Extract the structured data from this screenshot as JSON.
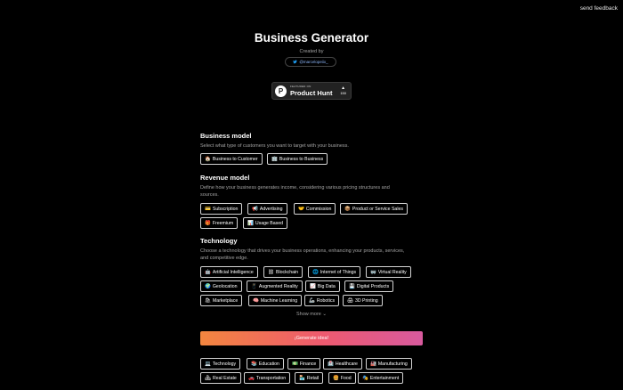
{
  "header": {
    "feedback": "send feedback",
    "title": "Business Generator",
    "created_by": "Created by",
    "twitter_handle": "@marcelopeiix_"
  },
  "product_hunt": {
    "featured": "FEATURED ON",
    "name": "Product Hunt",
    "votes": "150",
    "logo_letter": "P"
  },
  "business_model": {
    "heading": "Business model",
    "description": "Select what type of customers you want to target with your business.",
    "options": [
      {
        "icon": "🏠",
        "label": "Business to Customer"
      },
      {
        "icon": "🏢",
        "label": "Business to Business"
      }
    ]
  },
  "revenue_model": {
    "heading": "Revenue model",
    "description_1": "Define how your business generates income, considering various pricing structures and",
    "description_2": "sources.",
    "options": [
      {
        "icon": "💳",
        "label": "Subscription"
      },
      {
        "icon": "📢",
        "label": "Advertising"
      },
      {
        "icon": "🤝",
        "label": "Commission"
      },
      {
        "icon": "📦",
        "label": "Product or Service Sales"
      },
      {
        "icon": "🎁",
        "label": "Freemium"
      },
      {
        "icon": "📊",
        "label": "Usage Based"
      }
    ]
  },
  "technology": {
    "heading": "Technology",
    "description_1": "Choose a technology that drives your business operations, enhancing your products, services,",
    "description_2": "and competitive edge.",
    "options": [
      {
        "icon": "🤖",
        "label": "Artificial Intelligence"
      },
      {
        "icon": "⛓",
        "label": "Blockchain"
      },
      {
        "icon": "🌐",
        "label": "Internet of Things"
      },
      {
        "icon": "🥽",
        "label": "Virtual Reality"
      },
      {
        "icon": "🌍",
        "label": "Geolocation"
      },
      {
        "icon": "📱",
        "label": "Augmented Reality"
      },
      {
        "icon": "📈",
        "label": "Big Data"
      },
      {
        "icon": "💾",
        "label": "Digital Products"
      },
      {
        "icon": "🛍",
        "label": "Marketplace"
      },
      {
        "icon": "🧠",
        "label": "Machine Learning"
      },
      {
        "icon": "🦾",
        "label": "Robotics"
      },
      {
        "icon": "🖨",
        "label": "3D Printing"
      }
    ],
    "show_more": "Show more"
  },
  "generate": {
    "label": "¡Generate idea!"
  },
  "industries": {
    "options": [
      {
        "icon": "💻",
        "label": "Technology"
      },
      {
        "icon": "📚",
        "label": "Education"
      },
      {
        "icon": "💵",
        "label": "Finance"
      },
      {
        "icon": "🏥",
        "label": "Healthcare"
      },
      {
        "icon": "🏭",
        "label": "Manufacturing"
      },
      {
        "icon": "🏘",
        "label": "Real Estate"
      },
      {
        "icon": "🚗",
        "label": "Transportation"
      },
      {
        "icon": "🏪",
        "label": "Retail"
      },
      {
        "icon": "🍔",
        "label": "Food"
      },
      {
        "icon": "🎭",
        "label": "Entertainment"
      }
    ]
  }
}
